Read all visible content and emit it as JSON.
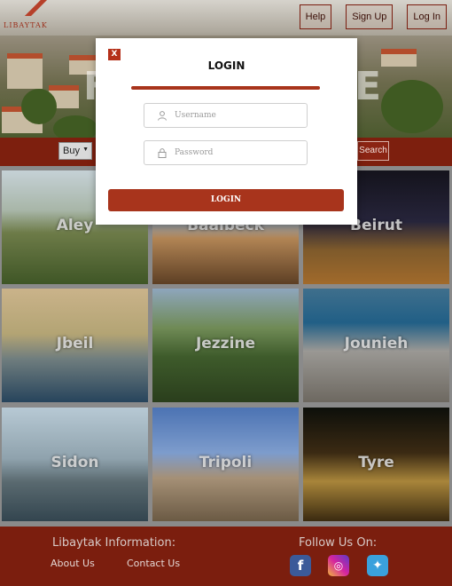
{
  "logo": {
    "text": "LIBAYTAK"
  },
  "nav": {
    "help": "Help",
    "signup": "Sign Up",
    "login": "Log In"
  },
  "hero": {
    "left_letter": "F",
    "right_letter": "E"
  },
  "search": {
    "buy_value": "Buy",
    "button": "Search"
  },
  "cities": [
    {
      "name": "Aley"
    },
    {
      "name": "Baalbeck"
    },
    {
      "name": "Beirut"
    },
    {
      "name": "Jbeil"
    },
    {
      "name": "Jezzine"
    },
    {
      "name": "Jounieh"
    },
    {
      "name": "Sidon"
    },
    {
      "name": "Tripoli"
    },
    {
      "name": "Tyre"
    }
  ],
  "footer": {
    "info_title": "Libaytak Information:",
    "about": "About Us",
    "contact": "Contact Us",
    "follow_title": "Follow Us On:"
  },
  "modal": {
    "close": "X",
    "title": "LOGIN",
    "username_placeholder": "Username",
    "password_placeholder": "Password",
    "submit": "LOGIN"
  },
  "colors": {
    "brand": "#7b1e0e",
    "accent": "#a8341c"
  }
}
